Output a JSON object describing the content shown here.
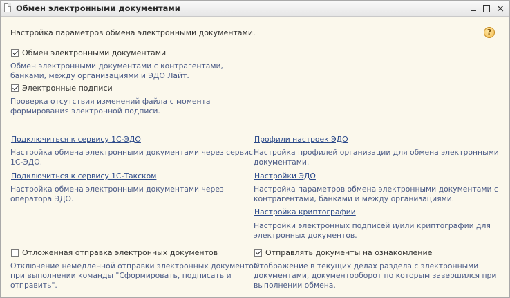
{
  "window": {
    "title": "Обмен электронными документами",
    "controls": {
      "minimize": "minimize-icon",
      "maximize": "maximize-icon",
      "close": "×"
    }
  },
  "header_text": "Настройка параметров обмена электронными документами.",
  "help_icon": "?",
  "options": {
    "edo": {
      "label": "Обмен электронными документами",
      "checked": true,
      "desc1": "Обмен электронными документами с контрагентами,",
      "desc2": "банками, между организациями и ЭДО Лайт."
    },
    "signatures": {
      "label": "Электронные подписи",
      "checked": true,
      "desc1": "Проверка отсутствия изменений файла с момента",
      "desc2": "формирования электронной подписи."
    }
  },
  "links_left": {
    "connect_1c_edo": {
      "label": "Подключиться к сервису 1С-ЭДО",
      "desc1": "Настройка обмена электронными документами через сервис",
      "desc2": "1С-ЭДО."
    },
    "connect_taxcom": {
      "label": "Подключиться к сервису 1С-Такском",
      "desc1": "Настройка обмена электронными документами через",
      "desc2": "оператора ЭДО."
    }
  },
  "links_right": {
    "profiles": {
      "label": "Профили настроек ЭДО",
      "desc1": "Настройка профилей организации для обмена электронными",
      "desc2": "документами."
    },
    "settings": {
      "label": "Настройки ЭДО",
      "desc1": "Настройка параметров обмена электронными документами с",
      "desc2": "контрагентами, банками и между организациями."
    },
    "crypto": {
      "label": "Настройка криптографии",
      "desc1": "Настройки электронных подписей и/или криптографии для",
      "desc2": "электронных документов."
    }
  },
  "bottom": {
    "deferred": {
      "label": "Отложенная отправка электронных документов",
      "checked": false,
      "desc1": "Отключение немедленной отправки электронных документов",
      "desc2": "при выполнении команды \"Сформировать, подписать и",
      "desc3": "отправить\"."
    },
    "review": {
      "label": "Отправлять документы на ознакомление",
      "checked": true,
      "desc1": "Отображение в текущих делах  раздела с электронными",
      "desc2": "документами, документооборот по которым завершился при",
      "desc3": "выполнении обмена."
    }
  }
}
